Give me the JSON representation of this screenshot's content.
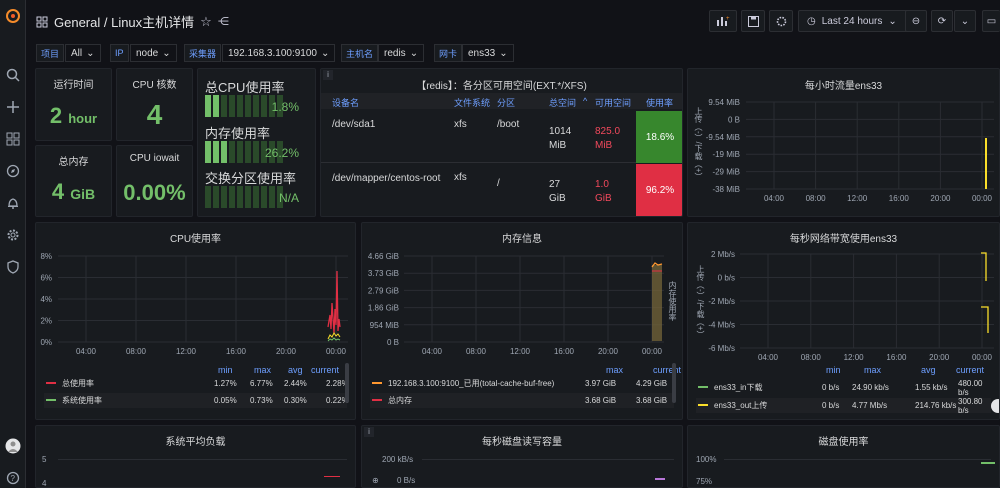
{
  "app": {
    "logo": "grafana-logo",
    "breadcrumb": "General / Linux主机详情"
  },
  "sidebar": {
    "items": [
      "search-icon",
      "plus-icon",
      "dashboards-icon",
      "explore-icon",
      "alert-bell-icon",
      "gear-icon",
      "shield-icon"
    ]
  },
  "toolbar": {
    "time_range": "Last 24 hours"
  },
  "variables": [
    {
      "label": "项目",
      "value": "All"
    },
    {
      "label": "IP",
      "value": "node"
    },
    {
      "label": "采集器",
      "value": "192.168.3.100:9100"
    },
    {
      "label": "主机名",
      "value": "redis"
    },
    {
      "label": "网卡",
      "value": "ens33"
    }
  ],
  "stats": {
    "uptime": {
      "title": "运行时间",
      "value": "2",
      "unit": "hour"
    },
    "cpu_cores": {
      "title": "CPU 核数",
      "value": "4"
    },
    "mem_total": {
      "title": "总内存",
      "value": "4",
      "unit": "GiB"
    },
    "cpu_iowait": {
      "title": "CPU iowait",
      "value": "0.00%"
    }
  },
  "gauges": {
    "cpu": {
      "title": "总CPU使用率",
      "value": "1.8%",
      "level": 0.2
    },
    "mem": {
      "title": "内存使用率",
      "value": "26.2%",
      "level": 0.3
    },
    "swap": {
      "title": "交换分区使用率",
      "value": "N/A",
      "level": 0
    }
  },
  "fs_table": {
    "title": "【redis】：各分区可用空间(EXT.*/XFS)",
    "headers": [
      "设备名",
      "文件系统",
      "分区",
      "总空间",
      "可用空间",
      "使用率"
    ],
    "rows": [
      {
        "device": "/dev/sda1",
        "fs": "xfs",
        "mount": "/boot",
        "total": "1014 MiB",
        "avail": "825.0 MiB",
        "usage": "18.6%",
        "color": "#37872d"
      },
      {
        "device": "/dev/mapper/centos-root",
        "fs": "xfs",
        "mount": "/",
        "total": "27 GiB",
        "avail": "1.0 GiB",
        "usage": "96.2%",
        "color": "#e02f44"
      }
    ]
  },
  "traffic_hour": {
    "title": "每小时流量ens33",
    "yticks": [
      "9.54 MiB",
      "0 B",
      "-9.54 MiB",
      "-19 MiB",
      "-29 MiB",
      "-38 MiB"
    ],
    "ylabel": "上传（-）/下载（+）",
    "xticks": [
      "04:00",
      "08:00",
      "12:00",
      "16:00",
      "20:00",
      "00:00"
    ]
  },
  "cpu_usage": {
    "title": "CPU使用率",
    "yticks": [
      "8%",
      "6%",
      "4%",
      "2%",
      "0%"
    ],
    "xticks": [
      "04:00",
      "08:00",
      "12:00",
      "16:00",
      "20:00",
      "00:00"
    ],
    "legend_headers": [
      "min",
      "max",
      "avg",
      "current"
    ],
    "legend": [
      {
        "name": "总使用率",
        "color": "#e02f44",
        "min": "1.27%",
        "max": "6.77%",
        "avg": "2.44%",
        "current": "2.28%"
      },
      {
        "name": "系统使用率",
        "color": "#73bf69",
        "min": "0.05%",
        "max": "0.73%",
        "avg": "0.30%",
        "current": "0.22%"
      }
    ]
  },
  "mem_info": {
    "title": "内存信息",
    "yticks": [
      "4.66 GiB",
      "3.73 GiB",
      "2.79 GiB",
      "1.86 GiB",
      "954 MiB",
      "0 B"
    ],
    "xticks": [
      "04:00",
      "08:00",
      "12:00",
      "16:00",
      "20:00",
      "00:00"
    ],
    "right_label": "内存使用率",
    "legend_headers": [
      "max",
      "current"
    ],
    "legend": [
      {
        "name": "192.168.3.100:9100_已用(total-cache-buf-free)",
        "color": "#ff9830",
        "max": "3.97 GiB",
        "current": "4.29 GiB"
      },
      {
        "name": "总内存",
        "color": "#e02f44",
        "max": "3.68 GiB",
        "current": "3.68 GiB"
      }
    ]
  },
  "net_bw": {
    "title": "每秒网络带宽使用ens33",
    "yticks": [
      "2 Mb/s",
      "0 b/s",
      "-2 Mb/s",
      "-4 Mb/s",
      "-6 Mb/s"
    ],
    "ylabel": "上传（-）/下载（+）",
    "xticks": [
      "04:00",
      "08:00",
      "12:00",
      "16:00",
      "20:00",
      "00:00"
    ],
    "legend_headers": [
      "min",
      "max",
      "avg",
      "current"
    ],
    "legend": [
      {
        "name": "ens33_in下载",
        "color": "#73bf69",
        "min": "0 b/s",
        "max": "24.90 kb/s",
        "avg": "1.55 kb/s",
        "current": "480.00 b/s"
      },
      {
        "name": "ens33_out上传",
        "color": "#fade2a",
        "min": "0 b/s",
        "max": "4.77 Mb/s",
        "avg": "214.76 kb/s",
        "current": "300.80 b/s"
      }
    ]
  },
  "load": {
    "title": "系统平均负载",
    "yticks": [
      "5",
      "4"
    ]
  },
  "disk_io": {
    "title": "每秒磁盘读写容量",
    "yticks": [
      "200 kB/s",
      "0 B/s"
    ]
  },
  "disk_usage": {
    "title": "磁盘使用率",
    "yticks": [
      "100%",
      "75%"
    ]
  }
}
